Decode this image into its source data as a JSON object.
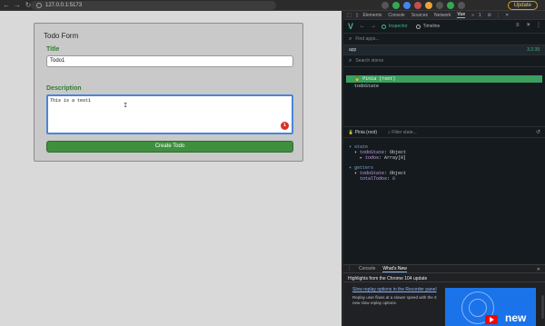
{
  "browser": {
    "url": "127.0.0.1:5173",
    "update_label": "Update"
  },
  "form": {
    "title": "Todo Form",
    "title_label": "Title",
    "title_value": "Todo1",
    "description_label": "Description",
    "description_value": "This is a test1",
    "badge_count": "1",
    "create_button": "Create Todo"
  },
  "devtools": {
    "tabs": [
      "Elements",
      "Console",
      "Sources",
      "Network",
      "Vue"
    ],
    "active_tab": "Vue",
    "badge": "1",
    "vue": {
      "inspector_label": "Inspector",
      "timeline_label": "Timeline",
      "find_apps_placeholder": "Find apps...",
      "app_name": "app",
      "version": "3.2.39",
      "search_stores_placeholder": "Search stores",
      "stores": [
        "Pinia (root)",
        "todoState"
      ],
      "state_header": "Pinia (root)",
      "filter_placeholder": "Filter state...",
      "state_section": "state",
      "state_key": "todoState",
      "state_type": "Object",
      "state_sub_key": "todos",
      "state_sub_value": "Array[0]",
      "getters_section": "getters",
      "getter_key": "todoState",
      "getter_type": "Object",
      "getter_sub_key": "totalTodos",
      "getter_sub_value": "0"
    },
    "drawer": {
      "tabs": [
        "Console",
        "What's New"
      ],
      "active_tab": "What's New",
      "highlights": "Highlights from the Chrome 104 update",
      "link_title": "Slow replay options in the Recorder panel",
      "link_desc": "Replay user flows at a slower speed with the 3 new slow replay options.",
      "thumb_text": "new"
    }
  }
}
